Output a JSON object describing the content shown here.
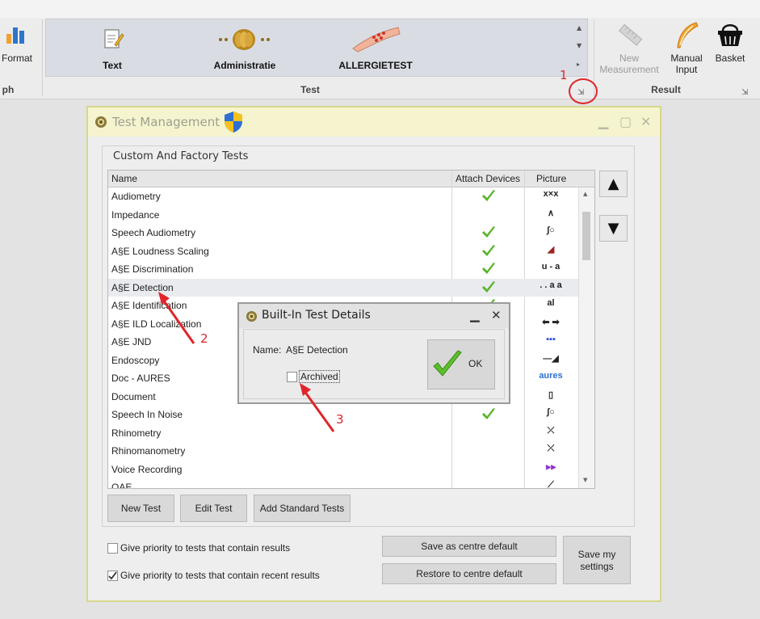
{
  "ribbon": {
    "left_partial": {
      "format_label": "Format",
      "group_caption": "ph"
    },
    "test_group": {
      "items": [
        {
          "label": "Text"
        },
        {
          "label": "Administratie"
        },
        {
          "label": "ALLERGIETEST"
        }
      ],
      "caption": "Test"
    },
    "result_group": {
      "new_measurement": "New\nMeasurement",
      "new_measurement_line1": "New",
      "new_measurement_line2": "Measurement",
      "manual_input_line1": "Manual",
      "manual_input_line2": "Input",
      "basket": "Basket",
      "caption": "Result"
    }
  },
  "test_management": {
    "title": "Test Management",
    "group_title": "Custom And Factory Tests",
    "columns": {
      "name": "Name",
      "attach": "Attach Devices",
      "picture": "Picture"
    },
    "rows": [
      {
        "name": "Audiometry",
        "attach": true,
        "pic": "audiogram-icon",
        "pic_text": "x×x"
      },
      {
        "name": "Impedance",
        "attach": false,
        "pic": "tympanogram-icon",
        "pic_text": "∧"
      },
      {
        "name": "Speech Audiometry",
        "attach": true,
        "pic": "speech-curve-icon",
        "pic_text": "∫○"
      },
      {
        "name": "A§E Loudness Scaling",
        "attach": true,
        "pic": "loudness-ramp-icon",
        "pic_text": "◢"
      },
      {
        "name": "A§E Discrimination",
        "attach": true,
        "pic": "discrimination-icon",
        "pic_text": "u - a"
      },
      {
        "name": "A§E Detection",
        "attach": true,
        "pic": "detection-icon",
        "pic_text": ". . a a"
      },
      {
        "name": "A§E Identification",
        "attach": true,
        "pic": "identification-icon",
        "pic_text": "al"
      },
      {
        "name": "A§E ILD Localization",
        "attach": false,
        "pic": "localization-arrows-icon",
        "pic_text": "⬅ ➡"
      },
      {
        "name": "A§E JND",
        "attach": false,
        "pic": "jnd-icon",
        "pic_text": "▪▪▪"
      },
      {
        "name": "Endoscopy",
        "attach": false,
        "pic": "endoscope-icon",
        "pic_text": "—◢"
      },
      {
        "name": "Doc - AURES",
        "attach": false,
        "pic": "aures-logo-icon",
        "pic_text": "aures"
      },
      {
        "name": "Document",
        "attach": false,
        "pic": "document-icon",
        "pic_text": "▯"
      },
      {
        "name": "Speech In Noise",
        "attach": true,
        "pic": "speech-noise-icon",
        "pic_text": "∫○"
      },
      {
        "name": "Rhinometry",
        "attach": false,
        "pic": "rhinometry-icon",
        "pic_text": "⤫"
      },
      {
        "name": "Rhinomanometry",
        "attach": false,
        "pic": "rhinomanometry-icon",
        "pic_text": "⤫"
      },
      {
        "name": "Voice Recording",
        "attach": false,
        "pic": "voice-wave-icon",
        "pic_text": "⫸⫸"
      },
      {
        "name": "OAE",
        "attach": false,
        "pic": "oae-icon",
        "pic_text": "⟋"
      }
    ],
    "buttons": {
      "new_test": "New Test",
      "edit_test": "Edit Test",
      "add_standard": "Add Standard Tests",
      "save_centre": "Save as centre default",
      "restore_centre": "Restore to centre default",
      "save_my_line1": "Save my",
      "save_my_line2": "settings"
    },
    "options": {
      "priority_results": {
        "label": "Give priority to tests that contain results",
        "checked": false
      },
      "priority_recent": {
        "label": "Give priority to tests that contain recent results",
        "checked": true
      }
    }
  },
  "dialog": {
    "title": "Built-In Test Details",
    "name_label": "Name:",
    "name_value": "A§E Detection",
    "archived_label": "Archived",
    "archived_checked": false,
    "ok_label": "OK"
  },
  "annotations": {
    "one": "1",
    "two": "2",
    "three": "3",
    "color": "#e0262a"
  },
  "colors": {
    "check_green": "#58b52b",
    "window_border": "#d6d78c",
    "title_bg": "#f5f4cf"
  }
}
